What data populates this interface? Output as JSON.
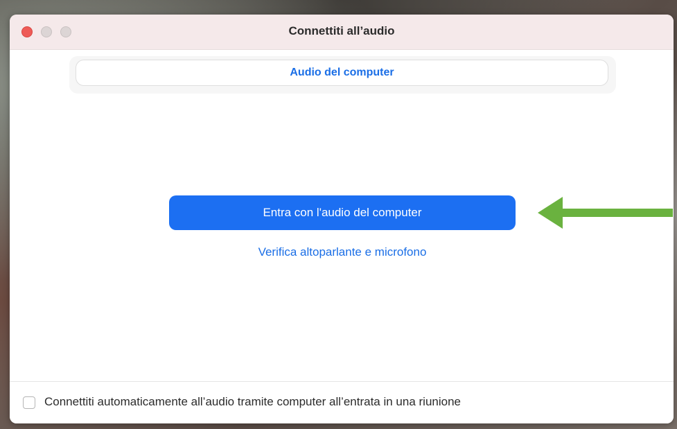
{
  "window": {
    "title": "Connettiti all’audio"
  },
  "tabs": [
    {
      "label": "Audio del computer",
      "selected": true
    }
  ],
  "main": {
    "join_button_label": "Entra con l'audio del computer",
    "test_link_label": "Verifica altoparlante e microfono"
  },
  "footer": {
    "auto_connect_label": "Connettiti automaticamente all’audio tramite computer all’entrata in una riunione",
    "auto_connect_checked": false
  },
  "annotation": {
    "arrow_color": "#6ab23f",
    "arrow_icon": "arrow-left-icon"
  },
  "colors": {
    "accent": "#1c6ff2",
    "link": "#1a6ee6",
    "close": "#ee5b57",
    "titlebar": "#f5e9ea"
  }
}
